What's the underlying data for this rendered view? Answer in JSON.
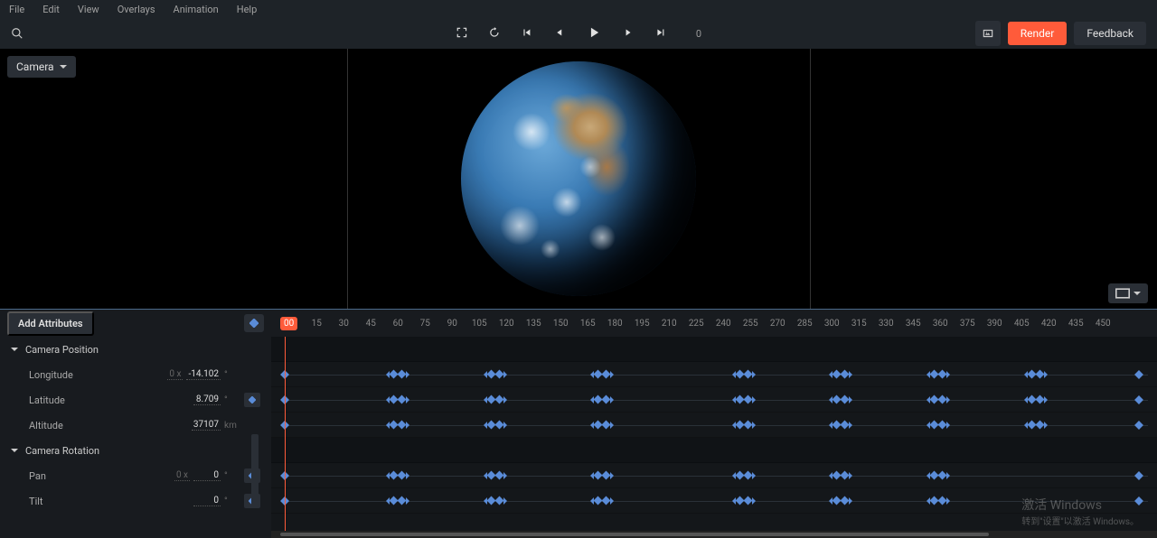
{
  "menu": {
    "file": "File",
    "edit": "Edit",
    "view": "View",
    "overlays": "Overlays",
    "animation": "Animation",
    "help": "Help"
  },
  "toolbar": {
    "frame": "0",
    "render": "Render",
    "feedback": "Feedback"
  },
  "viewport": {
    "camera_dropdown": "Camera"
  },
  "timeline": {
    "add_attributes": "Add Attributes",
    "ruler_current": "00",
    "ruler_marks": [
      "15",
      "30",
      "45",
      "60",
      "75",
      "90",
      "105",
      "120",
      "135",
      "150",
      "165",
      "180",
      "195",
      "210",
      "225",
      "240",
      "255",
      "270",
      "285",
      "300",
      "315",
      "330",
      "345",
      "360",
      "375",
      "390",
      "405",
      "420",
      "435",
      "450"
    ],
    "groups": {
      "camera_position": {
        "label": "Camera Position",
        "longitude": {
          "label": "Longitude",
          "prefix": "0 x",
          "value": "-14.102",
          "unit": "°"
        },
        "latitude": {
          "label": "Latitude",
          "value": "8.709",
          "unit": "°"
        },
        "altitude": {
          "label": "Altitude",
          "value": "37107",
          "unit": "km"
        }
      },
      "camera_rotation": {
        "label": "Camera Rotation",
        "pan": {
          "label": "Pan",
          "prefix": "0 x",
          "value": "0",
          "unit": "°"
        },
        "tilt": {
          "label": "Tilt",
          "value": "0",
          "unit": "°"
        }
      }
    },
    "keyframe_positions_pct": {
      "single_start": 1.5,
      "single_end": 98,
      "clusters_full": [
        13,
        24,
        36,
        52,
        63,
        74,
        85
      ],
      "clusters_rot": [
        13,
        24,
        36,
        52,
        63,
        74
      ]
    }
  },
  "watermark": {
    "line1": "激活 Windows",
    "line2": "转到\"设置\"以激活 Windows。"
  }
}
